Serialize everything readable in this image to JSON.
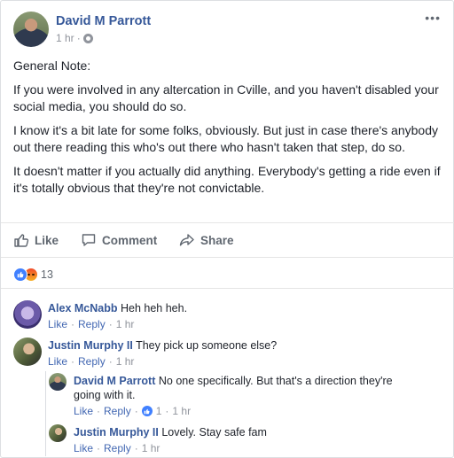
{
  "post": {
    "author": "David M Parrott",
    "time": "1 hr",
    "separator": "·",
    "more_label": "•••",
    "paragraphs": [
      "General Note:",
      "If you were involved in any altercation in Cville, and you haven't disabled your social media, you should do so.",
      "I know it's a bit late for some folks, obviously. But just in case there's anybody out there reading this who's out there who hasn't taken that step, do so.",
      "It doesn't matter if you actually did anything. Everybody's getting a ride even if it's totally obvious that they're not convictable."
    ]
  },
  "actions": {
    "like": "Like",
    "comment": "Comment",
    "share": "Share"
  },
  "reactions": {
    "count": "13",
    "types": [
      "like-icon",
      "angry-icon"
    ]
  },
  "comments": [
    {
      "author": "Alex McNabb",
      "text": "Heh heh heh.",
      "like": "Like",
      "reply": "Reply",
      "time": "1 hr"
    },
    {
      "author": "Justin Murphy II",
      "text": "They pick up someone else?",
      "like": "Like",
      "reply": "Reply",
      "time": "1 hr"
    },
    {
      "author": "David M Parrott",
      "text": "No one specifically. But that's a direction they're going with it.",
      "like": "Like",
      "reply": "Reply",
      "likes": "1",
      "time": "1 hr"
    },
    {
      "author": "Justin Murphy II",
      "text": "Lovely. Stay safe fam",
      "like": "Like",
      "reply": "Reply",
      "time": "1 hr"
    }
  ],
  "colors": {
    "link": "#365899",
    "meta": "#90949c",
    "like_blue": "#4080ff",
    "action_gray": "#606770"
  }
}
